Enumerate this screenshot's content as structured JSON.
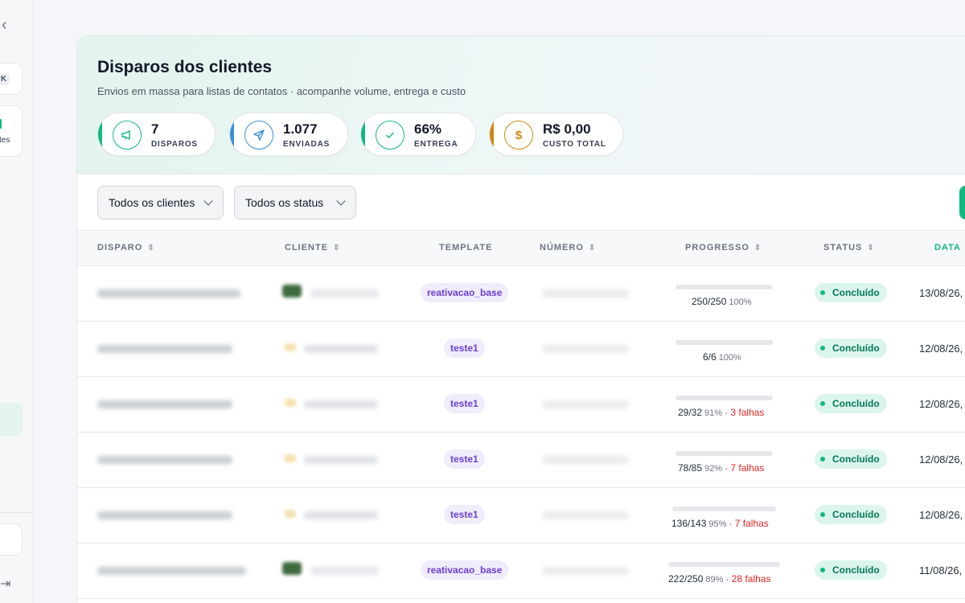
{
  "sidebar": {
    "kbd": "K",
    "item_text": "tes",
    "back_icon": "chevron-left-icon",
    "logout_icon": "logout-icon"
  },
  "header": {
    "title": "Disparos dos clientes",
    "subtitle": "Envios em massa para listas de contatos · acompanhe volume, entrega e custo"
  },
  "kpis": [
    {
      "value": "7",
      "label": "DISPAROS",
      "icon": "megaphone-icon",
      "color": "#10b981"
    },
    {
      "value": "1.077",
      "label": "ENVIADAS",
      "icon": "send-icon",
      "color": "#3b8fd8"
    },
    {
      "value": "66%",
      "label": "ENTREGA",
      "icon": "check-circle-icon",
      "color": "#10b981"
    },
    {
      "value": "R$ 0,00",
      "label": "CUSTO TOTAL",
      "icon": "dollar-icon",
      "color": "#c98a12"
    }
  ],
  "filters": {
    "client": "Todos os clientes",
    "status": "Todos os status"
  },
  "table": {
    "columns": [
      "DISPARO",
      "CLIENTE",
      "TEMPLATE",
      "NÚMERO",
      "PROGRESSO",
      "STATUS",
      "DATA"
    ],
    "rows": [
      {
        "template": "reativacao_base",
        "progress": "250/250",
        "pct": "100%",
        "fraction": 1.0,
        "failures": "",
        "status": "Concluído",
        "date": "13/08/26,"
      },
      {
        "template": "teste1",
        "progress": "6/6",
        "pct": "100%",
        "fraction": 1.0,
        "failures": "",
        "status": "Concluído",
        "date": "12/08/26,"
      },
      {
        "template": "teste1",
        "progress": "29/32",
        "pct": "91%",
        "fraction": 0.91,
        "failures": "· 3 falhas",
        "status": "Concluído",
        "date": "12/08/26,"
      },
      {
        "template": "teste1",
        "progress": "78/85",
        "pct": "92%",
        "fraction": 0.92,
        "failures": "· 7 falhas",
        "status": "Concluído",
        "date": "12/08/26,"
      },
      {
        "template": "teste1",
        "progress": "136/143",
        "pct": "95%",
        "fraction": 0.95,
        "failures": "· 7 falhas",
        "status": "Concluído",
        "date": "12/08/26,"
      },
      {
        "template": "reativacao_base",
        "progress": "222/250",
        "pct": "89%",
        "fraction": 0.89,
        "failures": "· 28 falhas",
        "status": "Concluído",
        "date": "11/08/26,"
      }
    ]
  }
}
